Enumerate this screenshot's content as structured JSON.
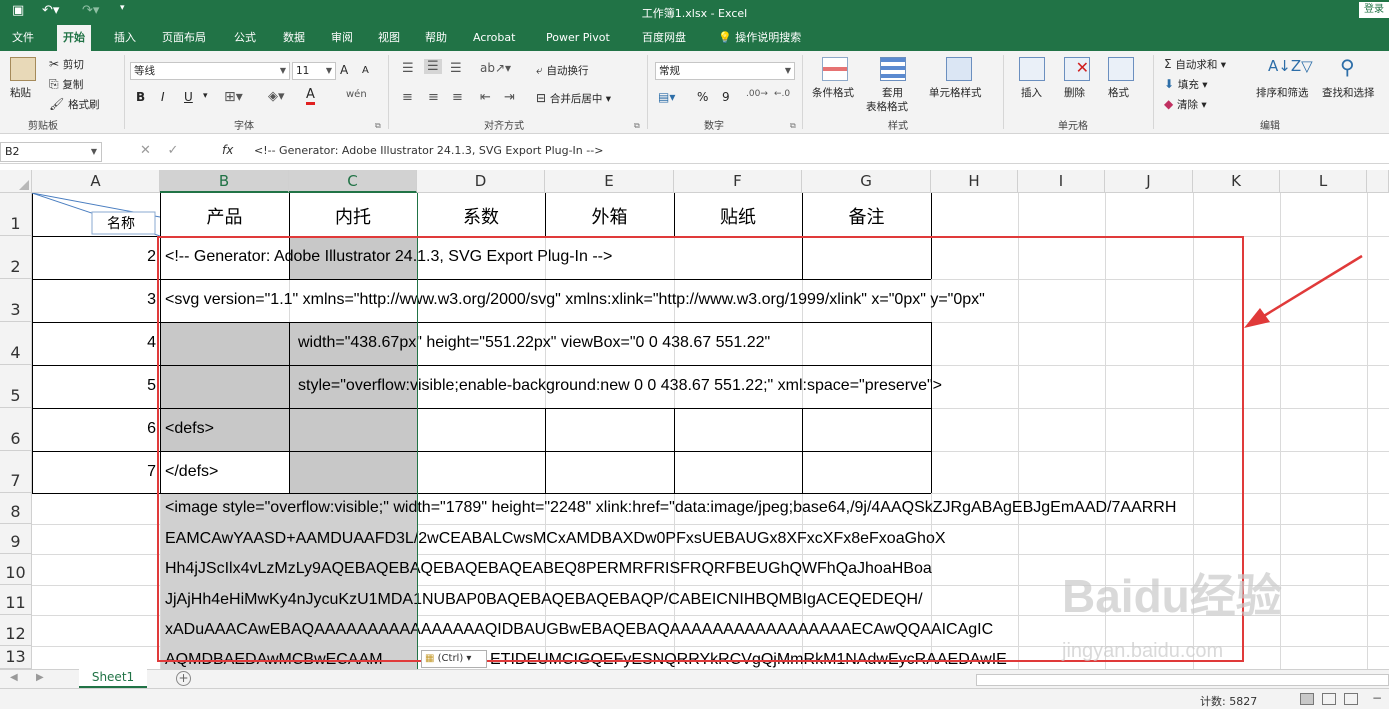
{
  "window": {
    "title": "工作簿1.xlsx - Excel",
    "login": "登录"
  },
  "tabs": [
    "文件",
    "开始",
    "插入",
    "页面布局",
    "公式",
    "数据",
    "审阅",
    "视图",
    "帮助",
    "Acrobat",
    "Power Pivot",
    "百度网盘"
  ],
  "active_tab": "开始",
  "tellme": "操作说明搜索",
  "ribbon": {
    "clipboard": {
      "paste": "粘贴",
      "cut": "剪切",
      "copy": "复制",
      "format_painter": "格式刷",
      "label": "剪贴板"
    },
    "font": {
      "name": "等线",
      "size": "11",
      "bold": "B",
      "italic": "I",
      "underline": "U",
      "grow": "A",
      "shrink": "A",
      "font_color": "A",
      "wen": "wén",
      "label": "字体"
    },
    "alignment": {
      "wrap": "自动换行",
      "merge": "合并后居中",
      "label": "对齐方式"
    },
    "number": {
      "format": "常规",
      "percent": "%",
      "comma": "9",
      "label": "数字"
    },
    "styles": {
      "cond": "条件格式",
      "table1": "套用",
      "table2": "表格格式",
      "cell": "单元格样式",
      "label": "样式"
    },
    "cells": {
      "insert": "插入",
      "delete": "删除",
      "format": "格式",
      "label": "单元格"
    },
    "editing": {
      "autosum": "自动求和",
      "fill": "填充",
      "clear": "清除",
      "sort": "排序和筛选",
      "find": "查找和选择",
      "label": "编辑"
    }
  },
  "formula_bar": {
    "name_box": "B2",
    "fx": "fx",
    "formula": "<!-- Generator: Adobe Illustrator 24.1.3, SVG Export Plug-In  -->"
  },
  "columns": [
    "A",
    "B",
    "C",
    "D",
    "E",
    "F",
    "G",
    "H",
    "I",
    "J",
    "K",
    "L"
  ],
  "rows": [
    "1",
    "2",
    "3",
    "4",
    "5",
    "6",
    "7",
    "8",
    "9",
    "10",
    "11",
    "12",
    "13"
  ],
  "table": {
    "corner_label": "名称",
    "headers": [
      "产品",
      "内托",
      "系数",
      "外箱",
      "贴纸",
      "备注"
    ],
    "row_numbers": [
      "2",
      "3",
      "4",
      "5",
      "6",
      "7"
    ]
  },
  "cells": {
    "r2": "<!-- Generator: Adobe Illustrator 24.1.3, SVG Export Plug-In  -->",
    "r3": "<svg version=\"1.1\" xmlns=\"http://www.w3.org/2000/svg\" xmlns:xlink=\"http://www.w3.org/1999/xlink\" x=\"0px\" y=\"0px\"",
    "r4": "width=\"438.67px\" height=\"551.22px\" viewBox=\"0 0 438.67 551.22\"",
    "r5": "style=\"overflow:visible;enable-background:new 0 0 438.67 551.22;\" xml:space=\"preserve\">",
    "r6": "<defs>",
    "r7": "</defs>",
    "r8": "<image style=\"overflow:visible;\" width=\"1789\" height=\"2248\" xlink:href=\"data:image/jpeg;base64,/9j/4AAQSkZJRgABAgEBJgEmAAD/7AARRH",
    "r9": "EAMCAwYAASD+AAMDUAAFD3L/2wCEABALCwsMCxAMDBAXDw0PFxsUEBAUGx8XFxcXFx8eFxoaGhoX",
    "r10": "Hh4jJScIlx4vLzMzLy9AQEBAQEBAQEBAQEBAQEABEQ8PERMRFRISFRQRFBEUGhQWFhQaJhoaHBoa",
    "r11": "JjAjHh4eHiMwKy4nJycuKzU1MDA1NUBAP0BAQEBAQEBAQEBAQP/CABEICNIHBQMBIgACEQEDEQH/",
    "r12": "xADuAAACAwEBAQAAAAAAAAAAAAAAAAQIDBAUGBwEBAQEBAQAAAAAAAAAAAAAAAAAECAwQQAAICAgIC",
    "r13": "AQMDBAEDAwMCBwECAAM",
    "r13b": "ETIDEUMCIGQEFyESNQRRYkRCVgQjMmRkM1NAdwEycRAAEDAwIE"
  },
  "paste_options": "(Ctrl) ▾",
  "sheet_tab": "Sheet1",
  "status": {
    "count": "计数: 5827"
  },
  "watermark": {
    "brand": "Baidu经验",
    "url": "jingyan.baidu.com"
  }
}
